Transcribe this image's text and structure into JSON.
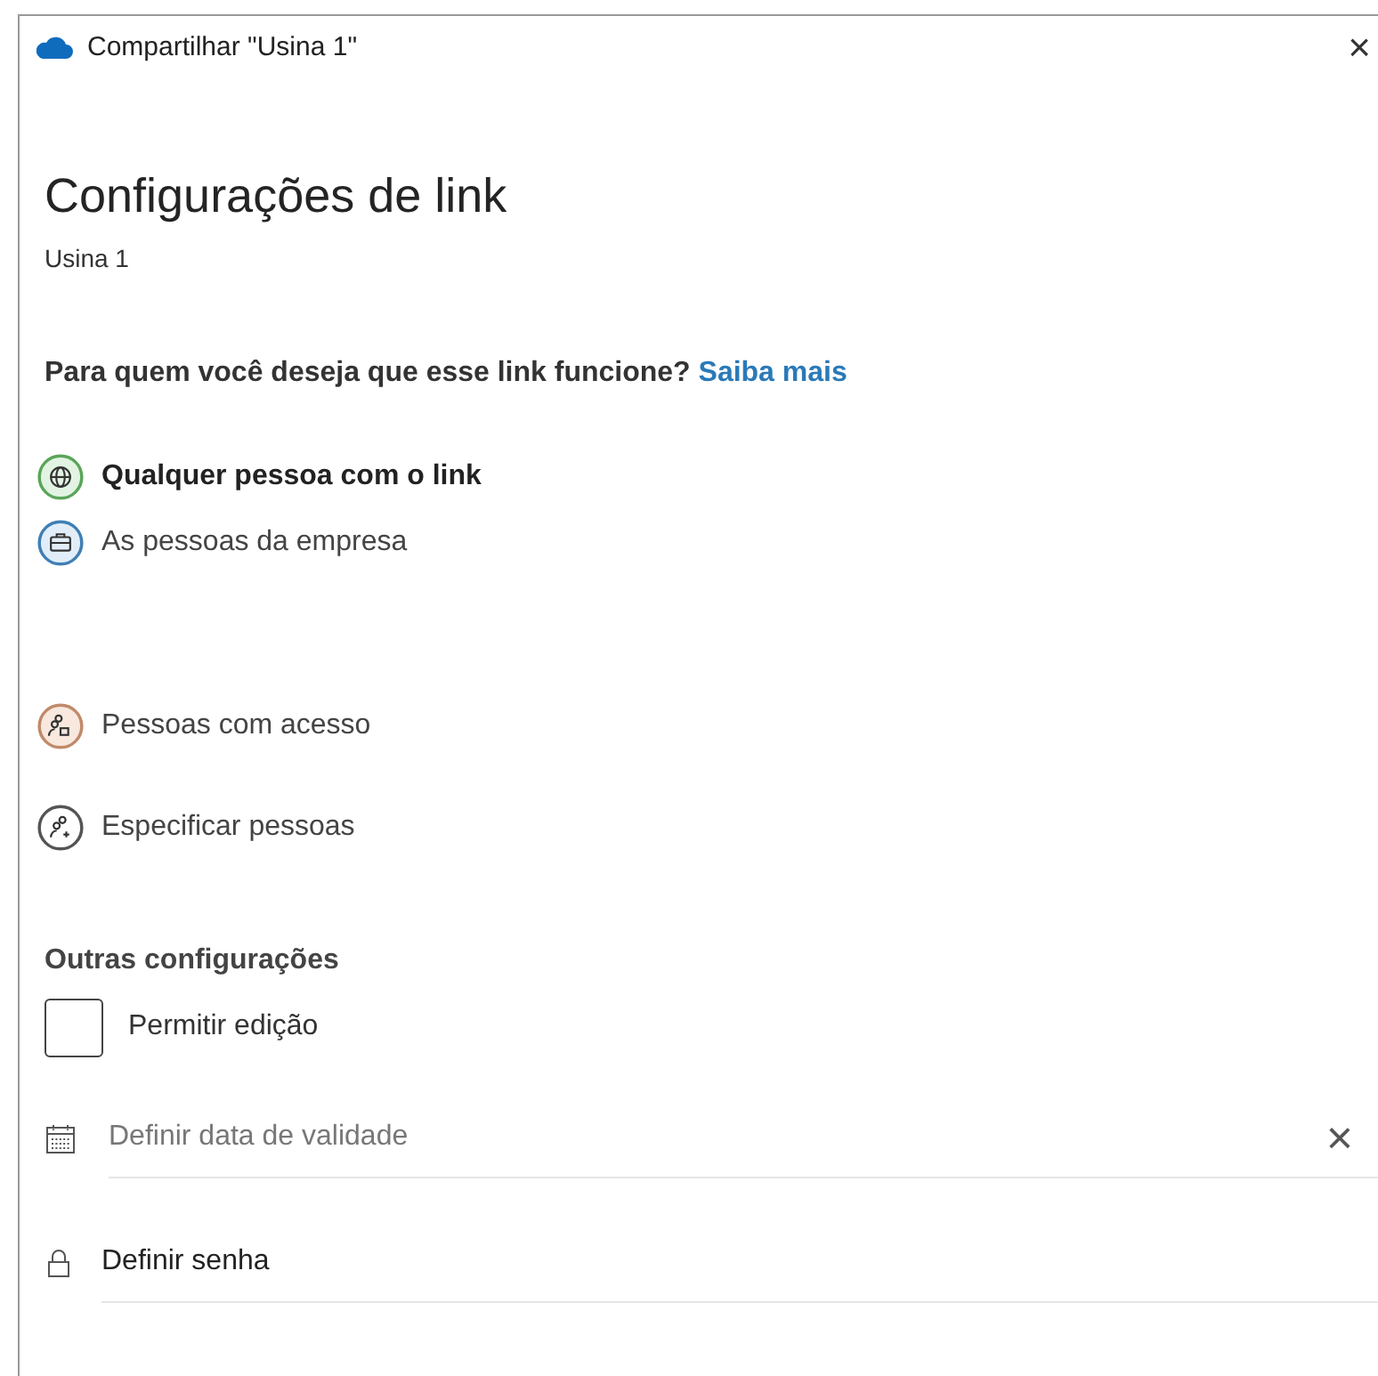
{
  "window": {
    "title": "Compartilhar \"Usina 1\"",
    "close": "×"
  },
  "heading": "Configurações de link",
  "subtitle": "Usina 1",
  "question": {
    "text": "Para quem você deseja que esse link funcione?",
    "link": "Saiba mais"
  },
  "options": [
    {
      "label": "Qualquer pessoa com o link",
      "selected": true,
      "kind": "globe",
      "color": "#5aa55a"
    },
    {
      "label": "As pessoas da empresa",
      "selected": false,
      "kind": "briefcase",
      "color": "#3f7fb5"
    },
    {
      "label": "Pessoas com acesso",
      "selected": false,
      "kind": "people-lock",
      "color": "#c08a6a"
    },
    {
      "label": "Especificar pessoas",
      "selected": false,
      "kind": "people-add",
      "color": "#555555"
    }
  ],
  "other_settings": {
    "title": "Outras configurações",
    "allow_edit": {
      "label": "Permitir edição",
      "checked": false
    },
    "expiry": {
      "placeholder": "Definir data de validade",
      "clear": "×"
    },
    "password": {
      "placeholder": "Definir senha"
    }
  }
}
